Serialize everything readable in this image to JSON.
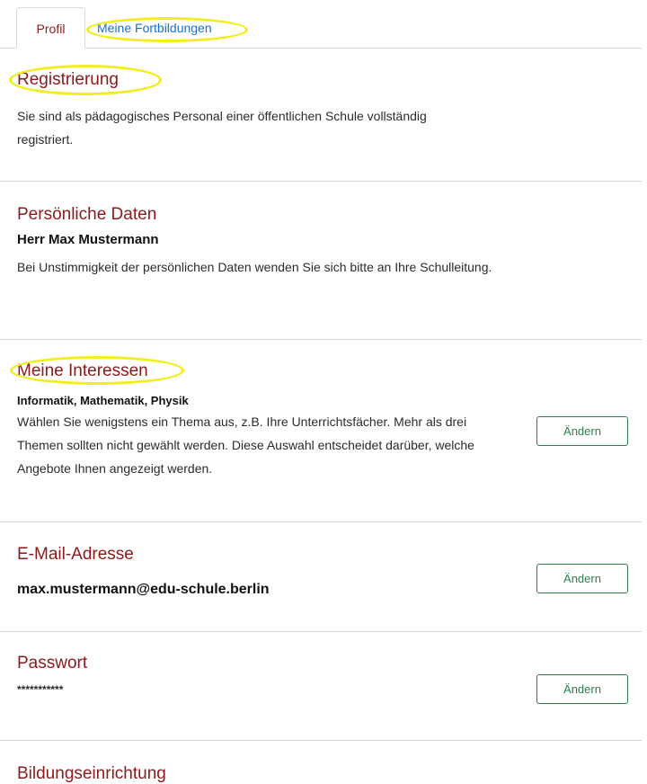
{
  "tabs": [
    {
      "label": "Profil"
    },
    {
      "label": "Meine Fortbildungen"
    }
  ],
  "registrierung": {
    "title": "Registrierung",
    "text": "Sie sind als pädagogisches Personal einer öffentlichen Schule vollständig registriert."
  },
  "persoenliche_daten": {
    "title": "Persönliche Daten",
    "name": "Herr Max Mustermann",
    "text": "Bei Unstimmigkeit der persönlichen Daten wenden Sie sich bitte an Ihre Schulleitung."
  },
  "interessen": {
    "title": "Meine Interessen",
    "selected": "Informatik, Mathematik, Physik",
    "text": "Wählen Sie wenigstens ein Thema aus, z.B. Ihre Unterrichtsfächer. Mehr als drei Themen sollten nicht gewählt werden. Diese Auswahl entscheidet darüber, welche Angebote Ihnen angezeigt werden.",
    "button": "Ändern"
  },
  "email": {
    "title": "E-Mail-Adresse",
    "value": "max.mustermann@edu-schule.berlin",
    "button": "Ändern"
  },
  "passwort": {
    "title": "Passwort",
    "value": "***********",
    "button": "Ändern"
  },
  "bildungseinrichtung": {
    "title": "Bildungseinrichtung"
  },
  "colors": {
    "heading": "#8b1a1a",
    "link": "#1d6fcc",
    "button": "#2e7d4f",
    "highlight": "#f2ee1b"
  }
}
